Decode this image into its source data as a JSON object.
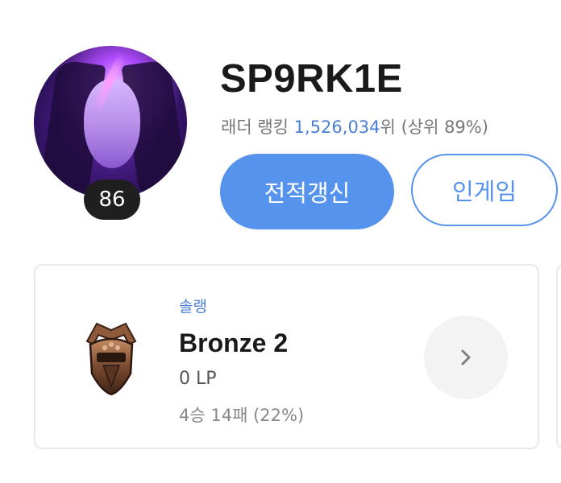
{
  "profile": {
    "level": "86",
    "name": "SP9RK1E",
    "ladder_label": "래더 랭킹",
    "ladder_rank": "1,526,034",
    "ladder_suffix": "위",
    "top_percent": "(상위 89%)"
  },
  "actions": {
    "refresh_label": "전적갱신",
    "ingame_label": "인게임"
  },
  "rank": {
    "queue": "솔랭",
    "tier": "Bronze 2",
    "lp": "0 LP",
    "record": "4승 14패 (22%)"
  },
  "icons": {
    "emblem": "bronze-emblem-icon",
    "chevron": "chevron-right-icon"
  },
  "colors": {
    "accent": "#5693ec",
    "rank_number": "#4a7fd6",
    "badge_bg": "#1f1f1f"
  }
}
